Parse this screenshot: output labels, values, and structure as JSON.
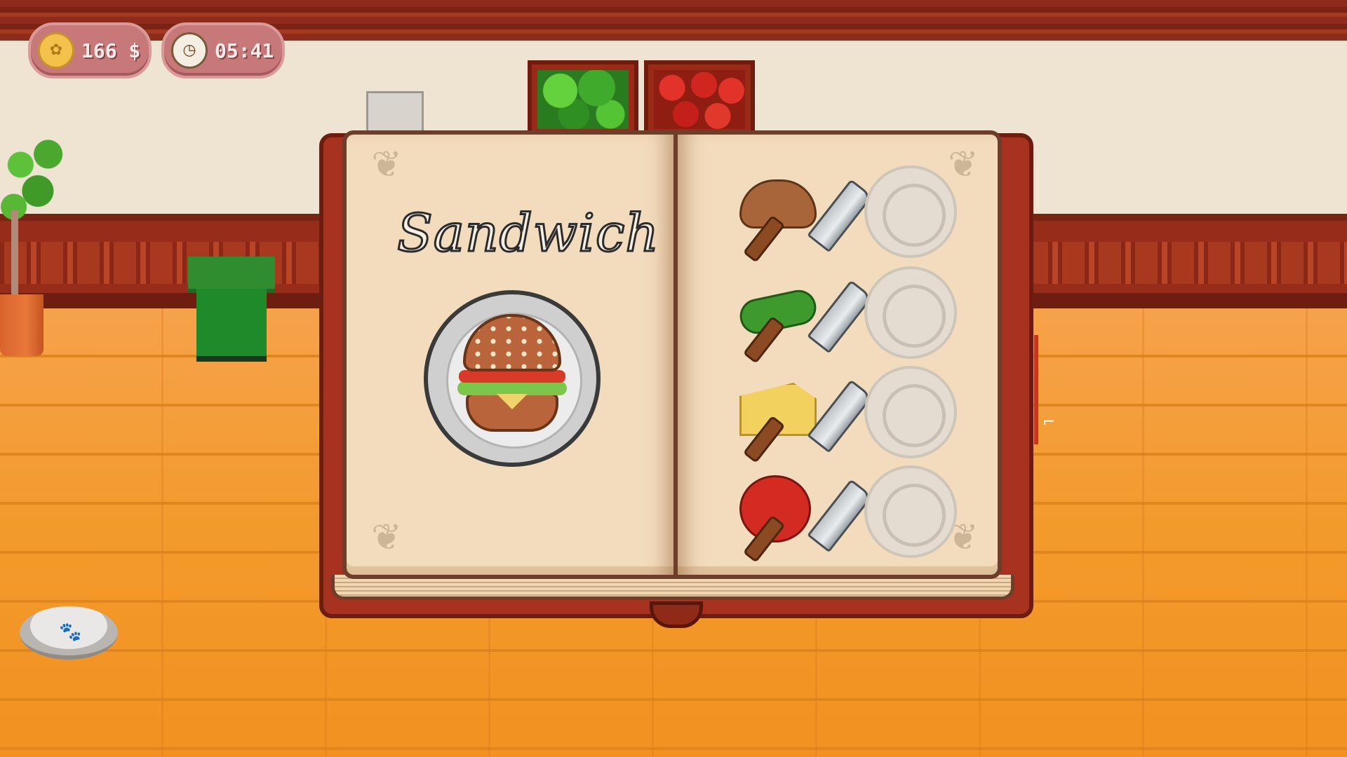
{
  "hud": {
    "money": "166 $",
    "time": "05:41",
    "money_icon": "coin-icon",
    "time_icon": "clock-icon"
  },
  "recipe": {
    "title": "Sandwich",
    "dish_icon": "sandwich-icon",
    "steps": [
      {
        "ingredient": "bread",
        "tool": "knife",
        "filled": false
      },
      {
        "ingredient": "cucumber",
        "tool": "knife",
        "filled": false
      },
      {
        "ingredient": "cheese",
        "tool": "knife",
        "filled": false
      },
      {
        "ingredient": "tomato",
        "tool": "knife",
        "filled": false
      }
    ]
  },
  "scene": {
    "props": [
      "potted-plant",
      "trash-bin",
      "lettuce-crate",
      "tomato-crate",
      "pet-bowl"
    ]
  },
  "colors": {
    "floor": "#f2a63a",
    "wall": "#efe3d2",
    "book_cover": "#a7321f",
    "page": "#f3dcbd",
    "hud_pill": "#c7797a"
  }
}
